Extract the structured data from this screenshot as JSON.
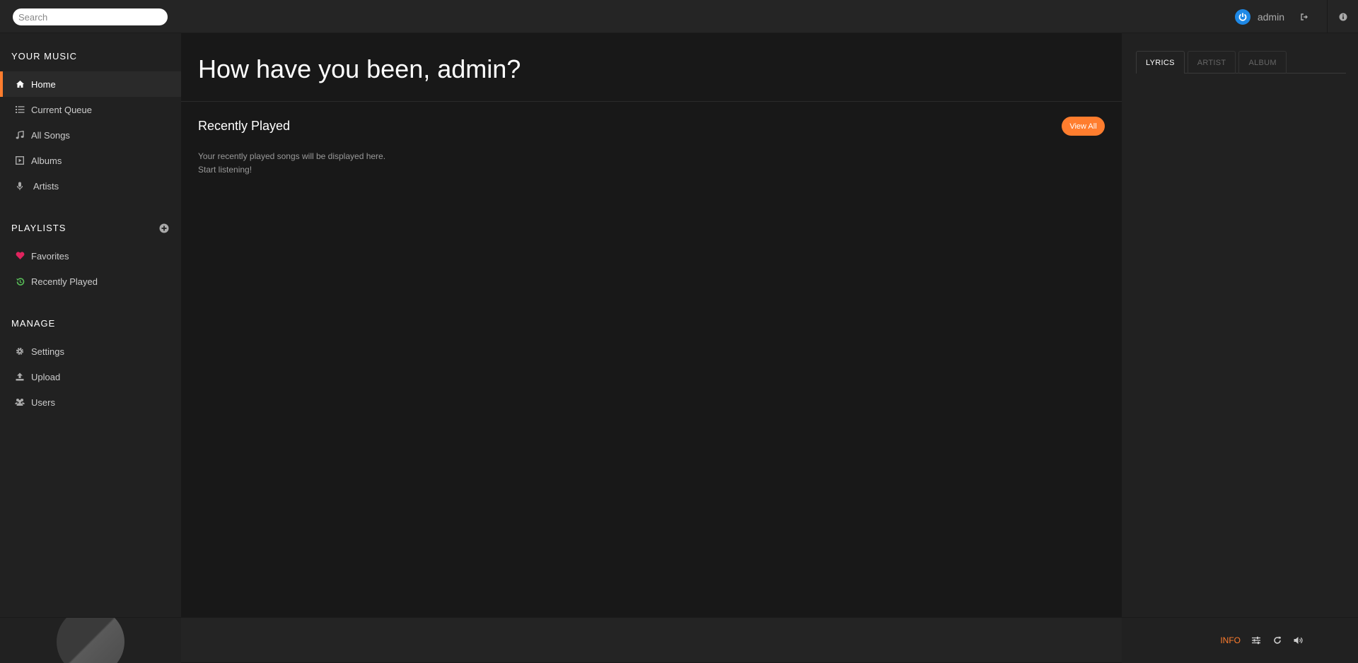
{
  "search": {
    "placeholder": "Search"
  },
  "user": {
    "name": "admin"
  },
  "sidebar": {
    "your_music_heading": "YOUR MUSIC",
    "items": [
      {
        "label": "Home"
      },
      {
        "label": "Current Queue"
      },
      {
        "label": "All Songs"
      },
      {
        "label": "Albums"
      },
      {
        "label": "Artists"
      }
    ],
    "playlists_heading": "PLAYLISTS",
    "playlists": [
      {
        "label": "Favorites"
      },
      {
        "label": "Recently Played"
      }
    ],
    "manage_heading": "MANAGE",
    "manage": [
      {
        "label": "Settings"
      },
      {
        "label": "Upload"
      },
      {
        "label": "Users"
      }
    ]
  },
  "main": {
    "greeting": "How have you been, admin?",
    "recently_played_title": "Recently Played",
    "view_all_label": "View All",
    "empty_line1": "Your recently played songs will be displayed here.",
    "empty_line2": "Start listening!"
  },
  "extra": {
    "tabs": [
      {
        "label": "LYRICS"
      },
      {
        "label": "ARTIST"
      },
      {
        "label": "ALBUM"
      }
    ]
  },
  "footer": {
    "info_label": "INFO"
  },
  "colors": {
    "accent": "#ff7d2e",
    "favorite": "#e0245e",
    "recent": "#58bd58",
    "avatar": "#1e88e5"
  }
}
